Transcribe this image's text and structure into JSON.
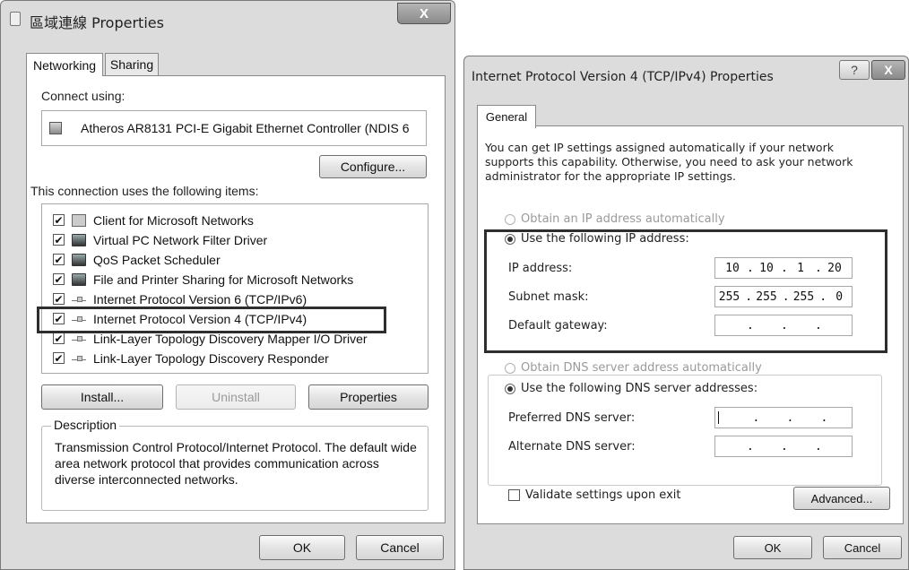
{
  "left_dialog": {
    "title": "區域連線 Properties",
    "close_glyph": "X",
    "tabs": [
      {
        "label": "Networking",
        "active": true
      },
      {
        "label": "Sharing",
        "active": false
      }
    ],
    "connect_using_label": "Connect using:",
    "adapter_name": "Atheros AR8131 PCI-E Gigabit Ethernet Controller (NDIS 6",
    "configure_label": "Configure...",
    "items_label": "This connection uses the following items:",
    "items": [
      {
        "label": "Client for Microsoft Networks",
        "checked": true,
        "icon": "client-icon"
      },
      {
        "label": "Virtual PC Network Filter Driver",
        "checked": true,
        "icon": "service-icon"
      },
      {
        "label": "QoS Packet Scheduler",
        "checked": true,
        "icon": "service-icon"
      },
      {
        "label": "File and Printer Sharing for Microsoft Networks",
        "checked": true,
        "icon": "service-icon"
      },
      {
        "label": "Internet Protocol Version 6 (TCP/IPv6)",
        "checked": true,
        "icon": "protocol-icon"
      },
      {
        "label": "Internet Protocol Version 4 (TCP/IPv4)",
        "checked": true,
        "icon": "protocol-icon"
      },
      {
        "label": "Link-Layer Topology Discovery Mapper I/O Driver",
        "checked": true,
        "icon": "protocol-icon"
      },
      {
        "label": "Link-Layer Topology Discovery Responder",
        "checked": true,
        "icon": "protocol-icon"
      }
    ],
    "install_label": "Install...",
    "uninstall_label": "Uninstall",
    "properties_label": "Properties",
    "description_label": "Description",
    "description_text": "Transmission Control Protocol/Internet Protocol. The default wide area network protocol that provides communication across diverse interconnected networks.",
    "ok_label": "OK",
    "cancel_label": "Cancel"
  },
  "right_dialog": {
    "title": "Internet Protocol Version 4 (TCP/IPv4) Properties",
    "help_glyph": "?",
    "close_glyph": "X",
    "tab_label": "General",
    "intro_text": "You can get IP settings assigned automatically if your network supports this capability. Otherwise, you need to ask your network administrator for the appropriate IP settings.",
    "obtain_ip_label": "Obtain an IP address automatically",
    "use_ip_label": "Use the following IP address:",
    "ip_address_label": "IP address:",
    "ip_address": [
      "10",
      "10",
      "1",
      "20"
    ],
    "subnet_label": "Subnet mask:",
    "subnet_mask": [
      "255",
      "255",
      "255",
      "0"
    ],
    "gateway_label": "Default gateway:",
    "gateway": [
      "",
      "",
      "",
      ""
    ],
    "obtain_dns_label": "Obtain DNS server address automatically",
    "use_dns_label": "Use the following DNS server addresses:",
    "preferred_dns_label": "Preferred DNS server:",
    "preferred_dns": [
      "",
      "",
      "",
      ""
    ],
    "alternate_dns_label": "Alternate DNS server:",
    "alternate_dns": [
      "",
      "",
      "",
      ""
    ],
    "validate_label": "Validate settings upon exit",
    "validate_checked": false,
    "advanced_label": "Advanced...",
    "ok_label": "OK",
    "cancel_label": "Cancel"
  },
  "check_glyph": "✔"
}
